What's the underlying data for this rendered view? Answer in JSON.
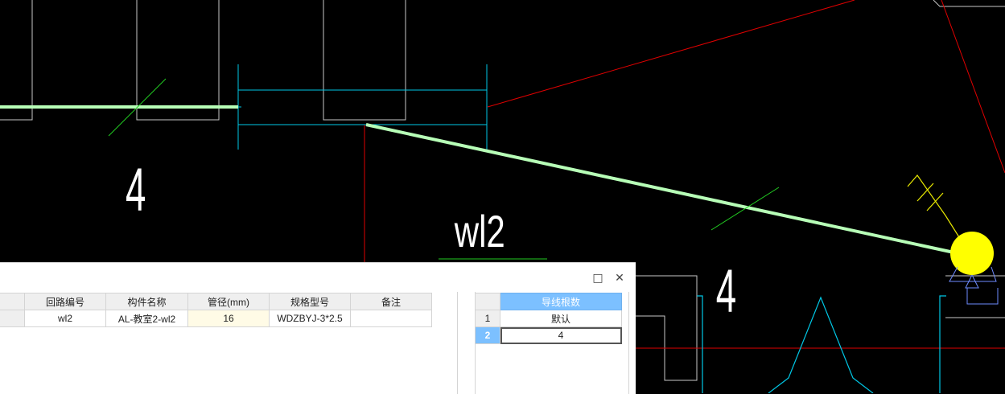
{
  "drawing": {
    "labels": [
      {
        "name": "count-label-left",
        "text": "4"
      },
      {
        "name": "circuit-label",
        "text": "wl2"
      },
      {
        "name": "count-label-right",
        "text": "4"
      }
    ],
    "colors": {
      "background": "#000000",
      "wire": "#b7ffb7",
      "tick": "#22cc22",
      "outline": "#c8c8c8",
      "cyan": "#00c8e6",
      "red": "#e00000",
      "fixture": "#ffff00"
    }
  },
  "panel": {
    "window_buttons": {
      "maximize_icon": "□",
      "close_icon": "✕"
    },
    "columns": [
      "回路编号",
      "构件名称",
      "管径(mm)",
      "规格型号",
      "备注"
    ],
    "rows": [
      {
        "circuit_no": "wl2",
        "component_name": "AL-教室2-wl2",
        "pipe_diameter": "16",
        "spec_model": "WDZBYJ-3*2.5",
        "remark": ""
      }
    ],
    "side_table": {
      "header": "导线根数",
      "rows": [
        {
          "index": "1",
          "value": "默认"
        },
        {
          "index": "2",
          "value": "4"
        }
      ],
      "selected_row": 2
    }
  }
}
